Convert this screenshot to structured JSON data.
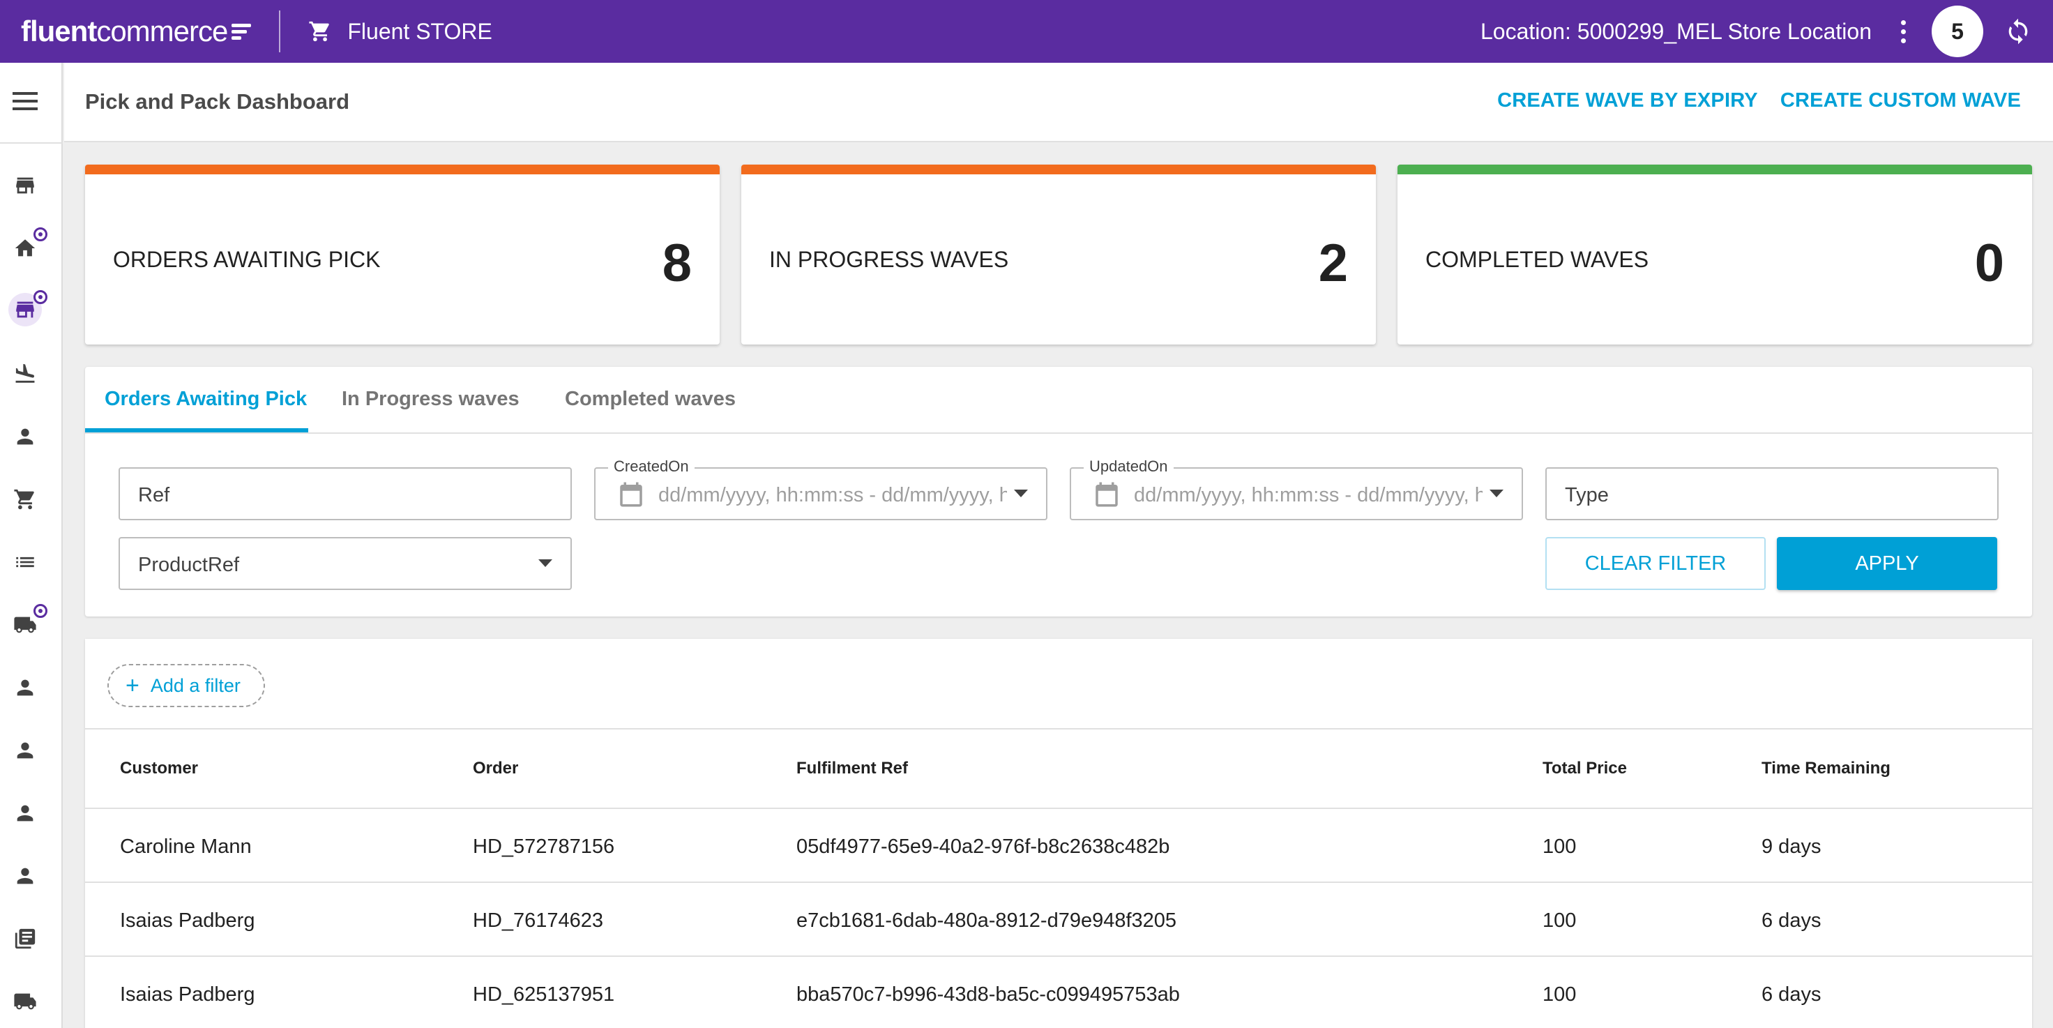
{
  "brand": {
    "name_bold": "fluent",
    "name_regular": "commerce"
  },
  "app": {
    "name": "Fluent STORE"
  },
  "topbar": {
    "location": "Location: 5000299_MEL Store Location",
    "badge_count": "5"
  },
  "header": {
    "title": "Pick and Pack Dashboard",
    "actions": [
      "CREATE WAVE BY EXPIRY",
      "CREATE CUSTOM WAVE"
    ]
  },
  "cards": [
    {
      "label": "ORDERS AWAITING PICK",
      "value": "8",
      "color": "#f26b1d"
    },
    {
      "label": "IN PROGRESS WAVES",
      "value": "2",
      "color": "#f26b1d"
    },
    {
      "label": "COMPLETED WAVES",
      "value": "0",
      "color": "#4caf50"
    }
  ],
  "tabs": [
    "Orders Awaiting Pick",
    "In Progress waves",
    "Completed waves"
  ],
  "filters": {
    "ref": "Ref",
    "created": {
      "label": "CreatedOn",
      "placeholder": "dd/mm/yyyy, hh:mm:ss - dd/mm/yyyy, hh"
    },
    "updated": {
      "label": "UpdatedOn",
      "placeholder": "dd/mm/yyyy, hh:mm:ss - dd/mm/yyyy, hh"
    },
    "type": "Type",
    "product_ref": "ProductRef",
    "clear": "CLEAR FILTER",
    "apply": "APPLY"
  },
  "table": {
    "add_filter": "Add a filter",
    "columns": [
      "Customer",
      "Order",
      "Fulfilment Ref",
      "Total Price",
      "Time Remaining"
    ],
    "rows": [
      [
        "Caroline Mann",
        "HD_572787156",
        "05df4977-65e9-40a2-976f-b8c2638c482b",
        "100",
        "9 days"
      ],
      [
        "Isaias Padberg",
        "HD_76174623",
        "e7cb1681-6dab-480a-8912-d79e948f3205",
        "100",
        "6 days"
      ],
      [
        "Isaias Padberg",
        "HD_625137951",
        "bba570c7-b996-43d8-ba5c-c099495753ab",
        "100",
        "6 days"
      ]
    ]
  },
  "icons": {
    "sidebar": [
      "store-icon",
      "home-icon",
      "storefront-icon",
      "flight-land-icon",
      "person-icon",
      "cart-icon",
      "list-icon",
      "truck-icon",
      "person-icon",
      "person-icon",
      "person-icon",
      "person-icon",
      "library-icon",
      "truck-icon"
    ]
  }
}
